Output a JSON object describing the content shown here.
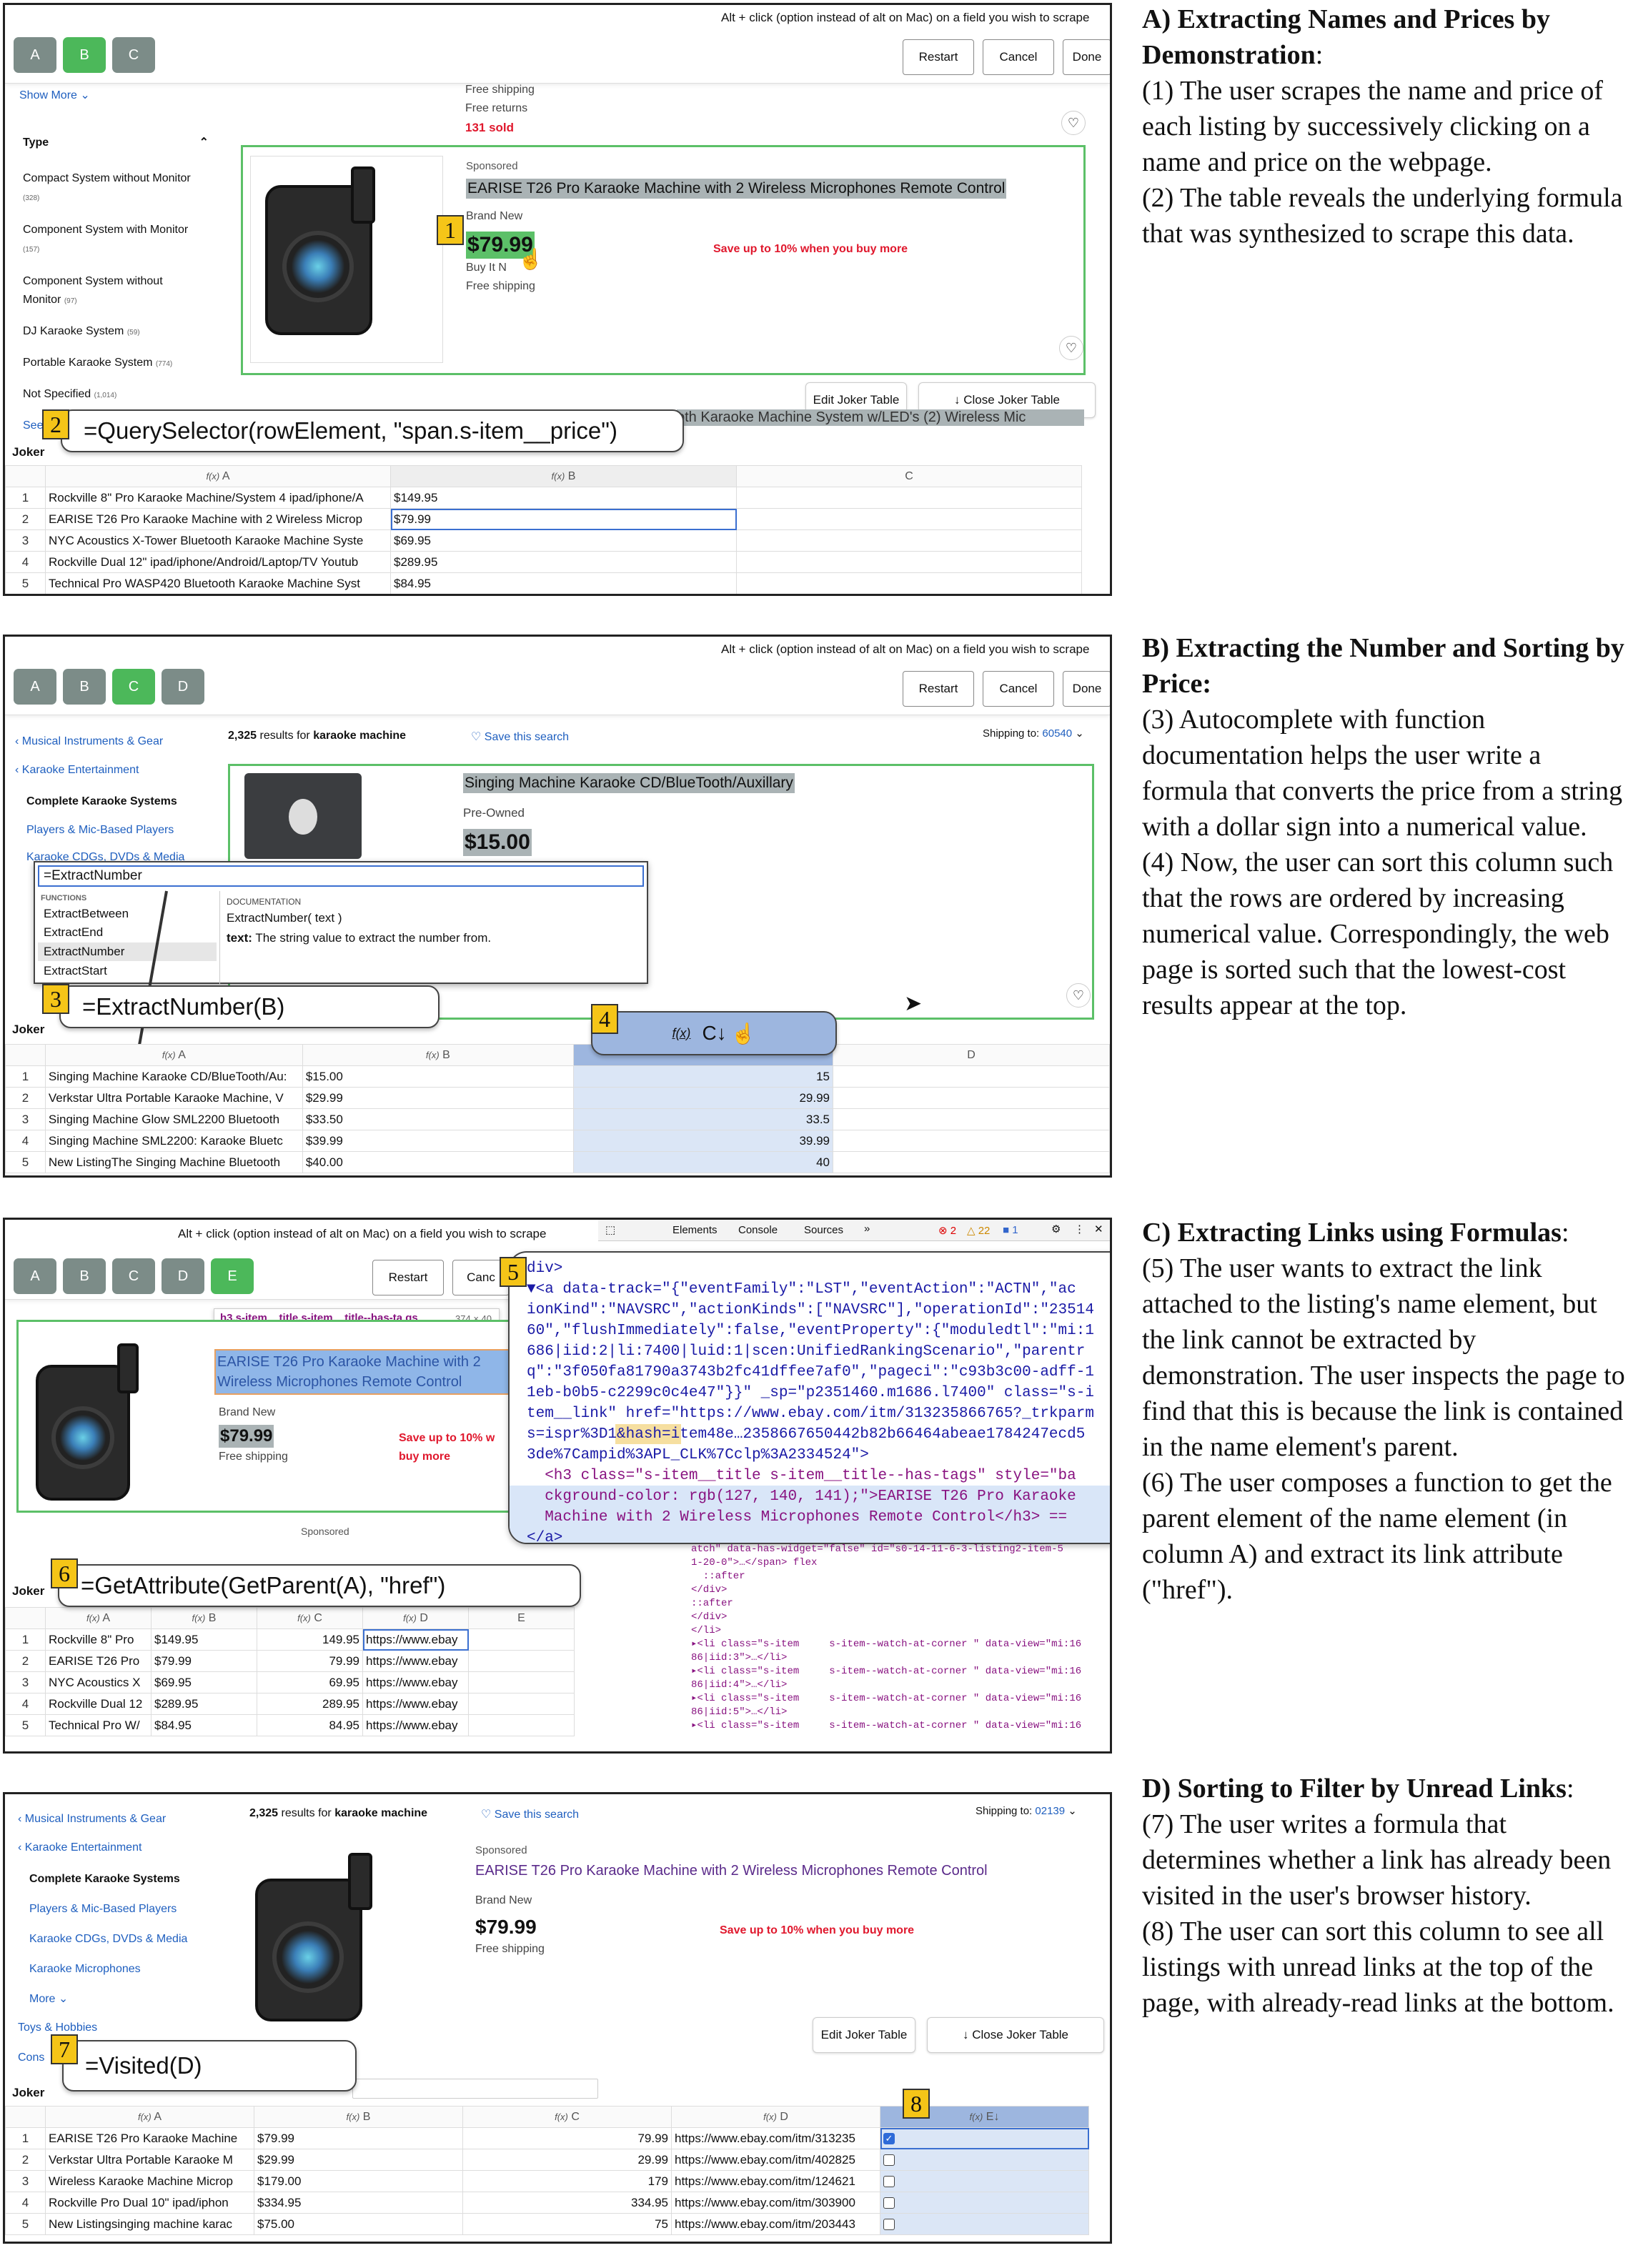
{
  "common": {
    "hint": "Alt + click (option instead of alt on Mac) on a field you wish to scrape",
    "restart": "Restart",
    "cancel": "Cancel",
    "done": "Done",
    "edit_joker": "Edit Joker Table",
    "close_joker": "↓ Close Joker Table",
    "joker": "Joker",
    "fx": "f(x)",
    "product_title": "EARISE T26 Pro Karaoke Machine with 2 Wireless Microphones Remote Control",
    "brand_new": "Brand New",
    "price": "$79.99",
    "buy_it_now": "Buy It N",
    "free_shipping": "Free shipping",
    "save_more": "Save up to 10% when you buy more",
    "sponsored": "Sponsored",
    "results_count": "2,325",
    "results_for": "results for",
    "query": "karaoke machine",
    "save_search": "Save this search",
    "shipping_to": "Shipping to:"
  },
  "panelA": {
    "tabs": [
      "A",
      "B",
      "C"
    ],
    "show_more": "Show More",
    "free_returns": "Free returns",
    "sold": "131 sold",
    "type_heading": "Type",
    "filters": [
      {
        "label": "Compact System without Monitor",
        "count": "(328)"
      },
      {
        "label": "Component System with Monitor",
        "count": "(157)"
      },
      {
        "label": "Component System without Monitor",
        "count": "(97)"
      },
      {
        "label": "DJ Karaoke System",
        "count": "(59)"
      },
      {
        "label": "Portable Karaoke System",
        "count": "(774)"
      },
      {
        "label": "Not Specified",
        "count": "(1,014)"
      }
    ],
    "see": "See",
    "formula": "=QuerySelector(rowElement, \"span.s-item__price\")",
    "obscured": "oth Karaoke Machine System w/LED's (2) Wireless Mic",
    "cols": [
      "A",
      "B",
      "C"
    ],
    "rows": [
      [
        "1",
        "Rockville 8\" Pro Karaoke Machine/System 4 ipad/iphone/A",
        "$149.95"
      ],
      [
        "2",
        "EARISE T26 Pro Karaoke Machine with 2 Wireless Microp",
        "$79.99"
      ],
      [
        "3",
        "NYC Acoustics X-Tower Bluetooth Karaoke Machine Syste",
        "$69.95"
      ],
      [
        "4",
        "Rockville Dual 12\" ipad/iphone/Android/Laptop/TV Youtub",
        "$289.95"
      ],
      [
        "5",
        "Technical Pro WASP420 Bluetooth Karaoke Machine Syst",
        "$84.95"
      ]
    ]
  },
  "panelB": {
    "tabs": [
      "A",
      "B",
      "C",
      "D"
    ],
    "nav": [
      "‹ Musical Instruments & Gear",
      "‹ Karaoke Entertainment",
      "Complete Karaoke Systems",
      "Players & Mic-Based Players",
      "Karaoke CDGs, DVDs & Media"
    ],
    "zip": "60540",
    "product_title": "Singing Machine Karaoke CD/BlueTooth/Auxillary",
    "pre_owned": "Pre-Owned",
    "price": "$15.00",
    "autocomplete_input": "=ExtractNumber",
    "functions_heading": "FUNCTIONS",
    "functions": [
      "ExtractBetween",
      "ExtractEnd",
      "ExtractNumber",
      "ExtractStart"
    ],
    "doc_heading": "DOCUMENTATION",
    "doc_signature": "ExtractNumber( text )",
    "doc_param": "text:",
    "doc_desc": "The string value to extract the number from.",
    "formula": "=ExtractNumber(B)",
    "sort_col": "C↓",
    "cols": [
      "A",
      "B",
      "C",
      "D"
    ],
    "rows": [
      [
        "1",
        "Singing Machine Karaoke CD/BlueTooth/Au:",
        "$15.00",
        "15"
      ],
      [
        "2",
        "Verkstar Ultra Portable Karaoke Machine, V",
        "$29.99",
        "29.99"
      ],
      [
        "3",
        "Singing Machine Glow SML2200 Bluetooth",
        "$33.50",
        "33.5"
      ],
      [
        "4",
        "Singing Machine SML2200: Karaoke Bluetc",
        "$39.99",
        "39.99"
      ],
      [
        "5",
        "New ListingThe Singing Machine Bluetooth",
        "$40.00",
        "40"
      ]
    ]
  },
  "panelC": {
    "tabs": [
      "A",
      "B",
      "C",
      "D",
      "E"
    ],
    "cancel_partial": "Canc",
    "devtools_tabs": [
      "Elements",
      "Console",
      "Sources",
      "»"
    ],
    "devtools_counts": [
      "2",
      "22",
      "1"
    ],
    "tooltip_tag": "h3.s-item__title.s-item__title--has-ta gs",
    "tooltip_size": "374 × 40",
    "title_line1": "EARISE T26 Pro Karaoke Machine with 2",
    "title_line2": "Wireless Microphones Remote Control",
    "save_line1": "Save up to 10% w",
    "save_line2": "buy more",
    "code_lines": [
      "div>",
      "▼<a data-track=\"{\"eventFamily\":\"LST\",\"eventAction\":\"ACTN\",\"ac",
      "ionKind\":\"NAVSRC\",\"actionKinds\":[\"NAVSRC\"],\"operationId\":\"23514",
      "60\",\"flushImmediately\":false,\"eventProperty\":{\"moduledtl\":\"mi:1",
      "686|iid:2|li:7400|luid:1|scen:UnifiedRankingScenario\",\"parentr",
      "q\":\"3f050fa81790a3743b2fc41dffee7af0\",\"pageci\":\"c93b3c00-adff-1",
      "1eb-b0b5-c2299c0c4e47\"}}\" _sp=\"p2351460.m1686.l7400\" class=\"s-i",
      "tem__link\" href=\"https://www.ebay.com/itm/313235866765?_trkparm",
      "s=ispr%3D1&hash=item48e…2358667650442b82b66464abeae1784247ecd5",
      "3de%7Campid%3APL_CLK%7Cclp%3A2334524\">",
      "  <h3 class=\"s-item__title s-item__title--has-tags\" style=\"ba",
      "  ckground-color: rgb(127, 140, 141);\">EARISE T26 Pro Karaoke",
      "  Machine with 2 Wireless Microphones Remote Control</h3> ==",
      "</a>"
    ],
    "formula": "=GetAttribute(GetParent(A), \"href\")",
    "cols": [
      "A",
      "B",
      "C",
      "D",
      "E"
    ],
    "rows": [
      [
        "1",
        "Rockville 8\" Pro",
        "$149.95",
        "149.95",
        "https://www.ebay"
      ],
      [
        "2",
        "EARISE T26 Pro",
        "$79.99",
        "79.99",
        "https://www.ebay"
      ],
      [
        "3",
        "NYC Acoustics X",
        "$69.95",
        "69.95",
        "https://www.ebay"
      ],
      [
        "4",
        "Rockville Dual 12",
        "$289.95",
        "289.95",
        "https://www.ebay"
      ],
      [
        "5",
        "Technical Pro W/",
        "$84.95",
        "84.95",
        "https://www.ebay"
      ]
    ],
    "dom_lines": [
      "atch\" data-has-widget=\"false\" id=\"s0-14-11-6-3-listing2-item-5",
      "1-20-0\">…</span> flex",
      "  ::after",
      "</div>",
      "::after",
      "</div>",
      "</li>",
      "▸<li class=\"s-item     s-item--watch-at-corner \" data-view=\"mi:16",
      "86|iid:3\">…</li>",
      "▸<li class=\"s-item     s-item--watch-at-corner \" data-view=\"mi:16",
      "86|iid:4\">…</li>",
      "▸<li class=\"s-item     s-item--watch-at-corner \" data-view=\"mi:16",
      "86|iid:5\">…</li>",
      "▸<li class=\"s-item     s-item--watch-at-corner \" data-view=\"mi:16"
    ]
  },
  "panelD": {
    "nav": [
      "‹ Musical Instruments & Gear",
      "‹ Karaoke Entertainment",
      "Complete Karaoke Systems",
      "Players & Mic-Based Players",
      "Karaoke CDGs, DVDs & Media",
      "Karaoke Microphones",
      "More",
      "Toys & Hobbies",
      "Cons"
    ],
    "zip": "02139",
    "formula": "=Visited(D)",
    "sort_col": "E↓",
    "cols": [
      "A",
      "B",
      "C",
      "D",
      "E"
    ],
    "rows": [
      [
        "1",
        "EARISE T26 Pro Karaoke Machine",
        "$79.99",
        "79.99",
        "https://www.ebay.com/itm/313235",
        true
      ],
      [
        "2",
        "Verkstar Ultra Portable Karaoke M",
        "$29.99",
        "29.99",
        "https://www.ebay.com/itm/402825",
        false
      ],
      [
        "3",
        "Wireless Karaoke Machine Microp",
        "$179.00",
        "179",
        "https://www.ebay.com/itm/124621",
        false
      ],
      [
        "4",
        "Rockville Pro Dual 10\" ipad/iphon",
        "$334.95",
        "334.95",
        "https://www.ebay.com/itm/303900",
        false
      ],
      [
        "5",
        "New Listingsinging machine karac",
        "$75.00",
        "75",
        "https://www.ebay.com/itm/203443",
        false
      ]
    ]
  },
  "badges": [
    "1",
    "2",
    "3",
    "4",
    "5",
    "6",
    "7",
    "8"
  ],
  "descriptions": {
    "a": {
      "title": "A) Extracting Names and Prices by Demonstration",
      "title_end": ":",
      "body": "(1) The user scrapes the name and price of each listing by successively clicking on a name and price on the webpage.\n(2) The table reveals the underlying formula that was synthesized to scrape this data."
    },
    "b": {
      "title": "B) Extracting the Number and Sorting by Price:",
      "body": "(3) Autocomplete with function documentation helps the user write a formula that converts the price from a string with a dollar sign into a numerical value.\n(4) Now, the user can sort this column such that the rows are ordered by increasing numerical value. Correspondingly, the web page is sorted such that the lowest-cost results appear at the top."
    },
    "c": {
      "title": "C) Extracting Links using Formulas",
      "title_end": ":",
      "body": "(5) The user wants to extract the link attached to the listing's name element, but the link cannot be extracted by demonstration. The user inspects the page to find that this is because the link is contained in the name element's parent.\n(6) The user composes a function to get the parent element of the name element (in column A) and extract its link attribute (\"href\")."
    },
    "d": {
      "title": "D) Sorting to Filter by Unread Links",
      "title_end": ":",
      "body": "(7) The user writes a formula that determines whether a link has already been visited in the user's browser history.\n(8) The user can sort this column to see all listings with unread links at the top of the page, with already-read links at the bottom."
    }
  },
  "colors": {
    "tab_gray": "#7c8c88",
    "tab_active": "#4cb85a",
    "card_border": "#5cc068",
    "badge": "#f5c518",
    "link_blue": "#1f5fbf",
    "save_red": "#e0182d",
    "sort_col_bg": "#dbe6f6"
  }
}
